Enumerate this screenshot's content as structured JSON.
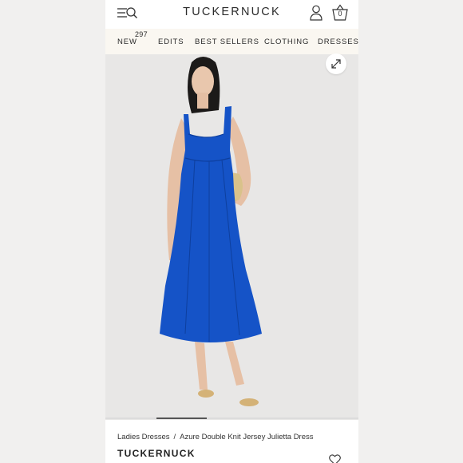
{
  "header": {
    "logo": "TUCKERNUCK",
    "cart_count": "0"
  },
  "nav": {
    "items": [
      {
        "label": "NEW",
        "badge": "297"
      },
      {
        "label": "EDITS"
      },
      {
        "label": "BEST SELLERS"
      },
      {
        "label": "CLOTHING"
      },
      {
        "label": "DRESSES"
      }
    ]
  },
  "product": {
    "dress_color": "#1553c7",
    "background_color": "#e8e7e6",
    "carousel_progress": 0.2
  },
  "breadcrumb": {
    "items": [
      "Ladies Dresses",
      "Azure Double Knit Jersey Julietta Dress"
    ],
    "separator": "/"
  },
  "brand": "TUCKERNUCK",
  "icons": [
    "menu-icon",
    "search-icon",
    "account-icon",
    "shopping-basket-icon",
    "expand-icon",
    "heart-icon"
  ]
}
